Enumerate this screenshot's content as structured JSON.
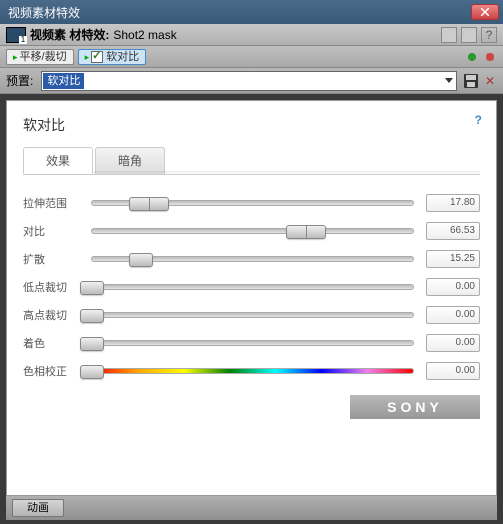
{
  "window": {
    "title": "视频素材特效"
  },
  "header": {
    "label": "视频素 材特效:",
    "subtitle": "Shot2 mask"
  },
  "chain": {
    "item1": "平移/裁切",
    "item2": "软对比"
  },
  "preset": {
    "label": "预置:",
    "selected": "软对比"
  },
  "panel": {
    "title": "软对比",
    "tabs": {
      "effects": "效果",
      "vignette": "暗角"
    },
    "params": [
      {
        "label": "拉伸范围",
        "value": "17.80",
        "pos": 17.8,
        "wide": true
      },
      {
        "label": "对比",
        "value": "66.53",
        "pos": 66.53,
        "wide": true
      },
      {
        "label": "扩散",
        "value": "15.25",
        "pos": 15.25
      },
      {
        "label": "低点裁切",
        "value": "0.00",
        "pos": 0
      },
      {
        "label": "高点裁切",
        "value": "0.00",
        "pos": 0
      },
      {
        "label": "着色",
        "value": "0.00",
        "pos": 0
      },
      {
        "label": "色相校正",
        "value": "0.00",
        "pos": 0,
        "hue": true
      }
    ],
    "brand": "SONY"
  },
  "footer": {
    "animate": "动画"
  }
}
